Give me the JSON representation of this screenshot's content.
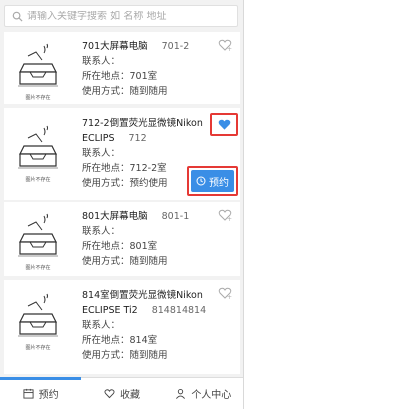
{
  "search": {
    "placeholder": "请输入关键字搜索 如 名称 地址"
  },
  "labels": {
    "contact": "联系人：",
    "location": "所在地点：",
    "usage": "使用方式："
  },
  "thumb_caption": "图片不存在",
  "items": [
    {
      "name": "701大屏幕电脑",
      "code": "701-2",
      "contact": "",
      "location": "701室",
      "usage": "随到随用",
      "favorited": false
    },
    {
      "name": "712-2倒置荧光显微镜Nikon",
      "name2": "ECLIPS",
      "code": "712",
      "contact": "",
      "location": "712-2室",
      "usage": "预约使用",
      "favorited": true,
      "book_label": "预约"
    },
    {
      "name": "801大屏幕电脑",
      "code": "801-1",
      "contact": "",
      "location": "801室",
      "usage": "随到随用",
      "favorited": false
    },
    {
      "name": "814室倒置荧光显微镜Nikon",
      "name2": "ECLIPSE Ti2",
      "code": "814814814",
      "contact": "",
      "location": "814室",
      "usage": "随到随用",
      "favorited": false
    }
  ],
  "tabs": [
    {
      "label": "预约",
      "icon": "calendar-icon",
      "active": true
    },
    {
      "label": "收藏",
      "icon": "heart-outline-icon",
      "active": false
    },
    {
      "label": "个人中心",
      "icon": "person-icon",
      "active": false
    }
  ],
  "colors": {
    "accent": "#3a8ee6",
    "highlight": "#e53935"
  }
}
